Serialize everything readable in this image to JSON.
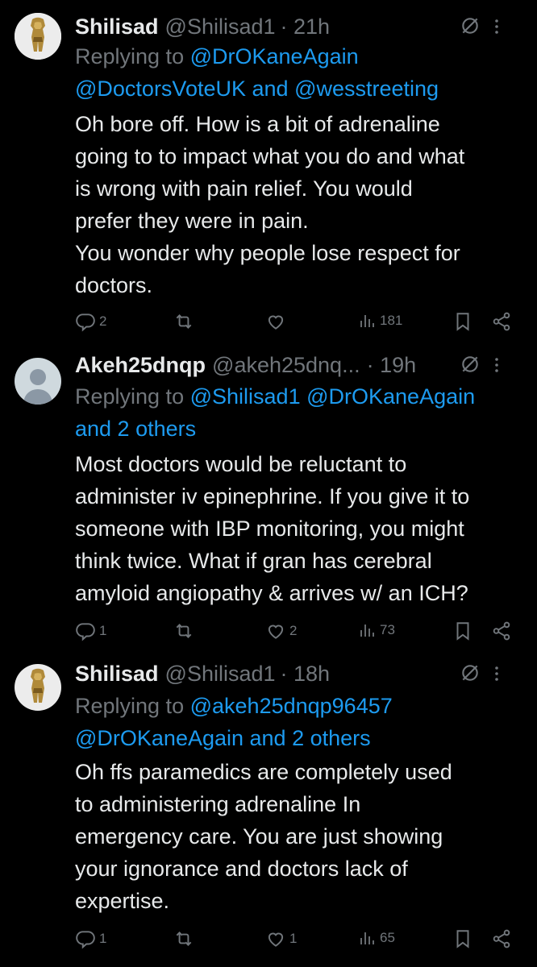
{
  "tweets": [
    {
      "name": "Shilisad",
      "handle": "@Shilisad1",
      "time": "· 21h",
      "replying_prefix": "Replying to",
      "reply_line1_mention": "@DrOKaneAgain",
      "reply_line2_mention_a": "@DoctorsVoteUK",
      "reply_line2_and": "and",
      "reply_line2_mention_b": "@wesstreeting",
      "body": [
        "Oh bore off. How is a bit of adrenaline",
        "going to to impact what you do and what",
        "is wrong with pain relief. You would",
        "prefer they were in pain.",
        "You wonder why people lose respect for",
        "doctors."
      ],
      "replies": "2",
      "retweets": "",
      "likes": "",
      "views": "181"
    },
    {
      "name": "Akeh25dnqp",
      "handle": "@akeh25dnq...",
      "time": "· 19h",
      "replying_prefix": "Replying to",
      "reply_line1_mention_a": "@Shilisad1",
      "reply_line1_mention_b": "@DrOKaneAgain",
      "reply_line2": "and 2 others",
      "body": [
        "Most doctors would be reluctant to",
        "administer iv epinephrine. If you give it to",
        "someone with IBP monitoring, you might",
        "think twice. What if gran has cerebral",
        "amyloid angiopathy & arrives w/ an ICH?"
      ],
      "replies": "1",
      "retweets": "",
      "likes": "2",
      "views": "73"
    },
    {
      "name": "Shilisad",
      "handle": "@Shilisad1",
      "time": "· 18h",
      "replying_prefix": "Replying to",
      "reply_line1_mention": "@akeh25dnqp96457",
      "reply_line2": "@DrOKaneAgain and 2 others",
      "body": [
        "Oh ffs paramedics are completely used",
        "to administering adrenaline In",
        "emergency care.  You are just showing",
        "your ignorance and doctors lack of",
        "expertise."
      ],
      "replies": "1",
      "retweets": "",
      "likes": "1",
      "views": "65"
    }
  ],
  "colors": {
    "background": "#000000",
    "text": "#e7e9ea",
    "muted": "#71767b",
    "link": "#1d9bf0"
  }
}
